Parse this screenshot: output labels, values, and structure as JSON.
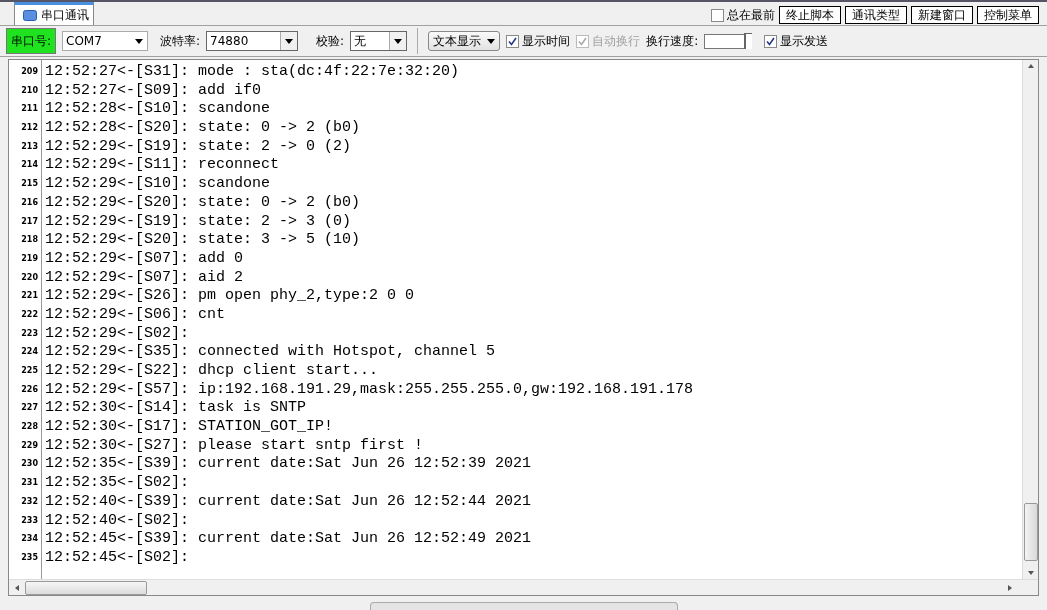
{
  "tabs": [
    {
      "label": "串口通讯",
      "selected": true
    }
  ],
  "top_options": [
    {
      "kind": "checkbox",
      "label": "总在最前",
      "checked": false
    },
    {
      "kind": "button",
      "label": "终止脚本"
    },
    {
      "kind": "button",
      "label": "通讯类型"
    },
    {
      "kind": "button",
      "label": "新建窗口"
    },
    {
      "kind": "button",
      "label": "控制菜单"
    }
  ],
  "port": {
    "label": "串口号:",
    "value": "COM7",
    "open": true
  },
  "baud": {
    "label": "波特率:",
    "value": "74880"
  },
  "parity": {
    "label": "校验:",
    "value": "无"
  },
  "display_mode": {
    "value": "文本显示"
  },
  "options": [
    {
      "label": "显示时间",
      "checked": true,
      "disabled": false
    },
    {
      "label": "自动换行",
      "checked": true,
      "disabled": true
    }
  ],
  "wrap_speed": {
    "label": "换行速度:"
  },
  "show_send": {
    "label": "显示发送",
    "checked": true,
    "disabled": false
  },
  "log": [
    {
      "number": "209",
      "text": "12:52:27<-[S31]: mode : sta(dc:4f:22:7e:32:20)"
    },
    {
      "number": "210",
      "text": "12:52:27<-[S09]: add if0"
    },
    {
      "number": "211",
      "text": "12:52:28<-[S10]: scandone"
    },
    {
      "number": "212",
      "text": "12:52:28<-[S20]: state: 0 -> 2 (b0)"
    },
    {
      "number": "213",
      "text": "12:52:29<-[S19]: state: 2 -> 0 (2)"
    },
    {
      "number": "214",
      "text": "12:52:29<-[S11]: reconnect"
    },
    {
      "number": "215",
      "text": "12:52:29<-[S10]: scandone"
    },
    {
      "number": "216",
      "text": "12:52:29<-[S20]: state: 0 -> 2 (b0)"
    },
    {
      "number": "217",
      "text": "12:52:29<-[S19]: state: 2 -> 3 (0)"
    },
    {
      "number": "218",
      "text": "12:52:29<-[S20]: state: 3 -> 5 (10)"
    },
    {
      "number": "219",
      "text": "12:52:29<-[S07]: add 0"
    },
    {
      "number": "220",
      "text": "12:52:29<-[S07]: aid 2"
    },
    {
      "number": "221",
      "text": "12:52:29<-[S26]: pm open phy_2,type:2 0 0"
    },
    {
      "number": "222",
      "text": "12:52:29<-[S06]: cnt"
    },
    {
      "number": "223",
      "text": "12:52:29<-[S02]:"
    },
    {
      "number": "224",
      "text": "12:52:29<-[S35]: connected with Hotspot, channel 5"
    },
    {
      "number": "225",
      "text": "12:52:29<-[S22]: dhcp client start..."
    },
    {
      "number": "226",
      "text": "12:52:29<-[S57]: ip:192.168.191.29,mask:255.255.255.0,gw:192.168.191.178"
    },
    {
      "number": "227",
      "text": "12:52:30<-[S14]: task is SNTP"
    },
    {
      "number": "228",
      "text": "12:52:30<-[S17]: STATION_GOT_IP!"
    },
    {
      "number": "229",
      "text": "12:52:30<-[S27]: please start sntp first !"
    },
    {
      "number": "230",
      "text": "12:52:35<-[S39]: current date:Sat Jun 26 12:52:39 2021"
    },
    {
      "number": "231",
      "text": "12:52:35<-[S02]:"
    },
    {
      "number": "232",
      "text": "12:52:40<-[S39]: current date:Sat Jun 26 12:52:44 2021"
    },
    {
      "number": "233",
      "text": "12:52:40<-[S02]:"
    },
    {
      "number": "234",
      "text": "12:52:45<-[S39]: current date:Sat Jun 26 12:52:49 2021"
    },
    {
      "number": "235",
      "text": "12:52:45<-[S02]:"
    }
  ]
}
